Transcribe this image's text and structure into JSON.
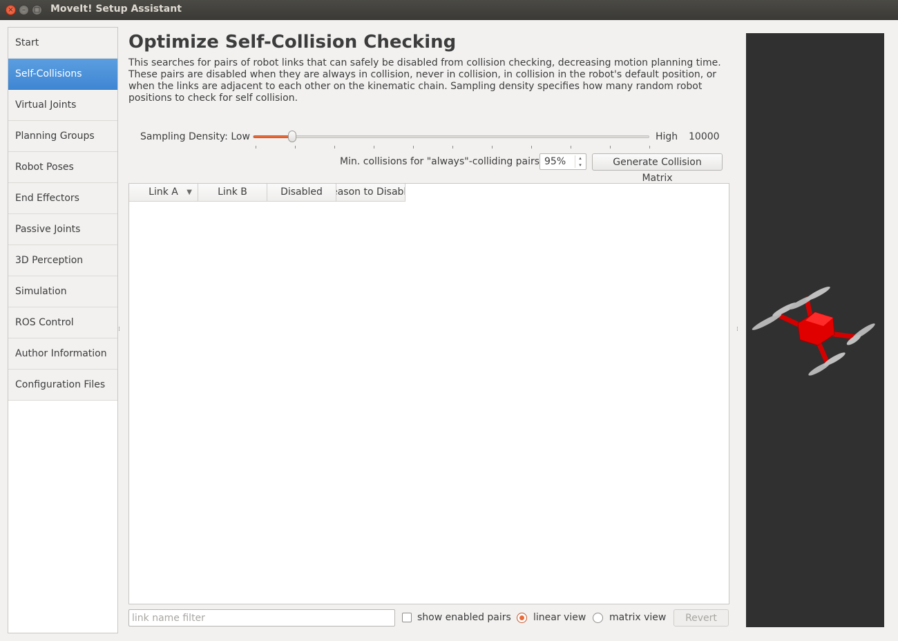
{
  "window": {
    "title": "MoveIt! Setup Assistant",
    "close_glyph": "×",
    "minimize_glyph": "–",
    "maximize_glyph": "□"
  },
  "sidebar": {
    "items": [
      {
        "label": "Start",
        "active": false
      },
      {
        "label": "Self-Collisions",
        "active": true
      },
      {
        "label": "Virtual Joints",
        "active": false
      },
      {
        "label": "Planning Groups",
        "active": false
      },
      {
        "label": "Robot Poses",
        "active": false
      },
      {
        "label": "End Effectors",
        "active": false
      },
      {
        "label": "Passive Joints",
        "active": false
      },
      {
        "label": "3D Perception",
        "active": false
      },
      {
        "label": "Simulation",
        "active": false
      },
      {
        "label": "ROS Control",
        "active": false
      },
      {
        "label": "Author Information",
        "active": false
      },
      {
        "label": "Configuration Files",
        "active": false
      }
    ]
  },
  "main": {
    "title": "Optimize Self-Collision Checking",
    "description": "This searches for pairs of robot links that can safely be disabled from collision checking, decreasing motion planning time. These pairs are disabled when they are always in collision, never in collision, in collision in the robot's default position, or when the links are adjacent to each other on the kinematic chain. Sampling density specifies how many random robot positions to check for self collision.",
    "sampling": {
      "label": "Sampling Density: Low",
      "high_label": "High",
      "value": "10000",
      "slider_fraction": 0.1
    },
    "min_collisions": {
      "label": "Min. collisions for \"always\"-colliding pairs:",
      "value": "95%"
    },
    "generate_button": "Generate Collision Matrix",
    "table": {
      "columns": [
        "Link A",
        "Link B",
        "Disabled",
        "Reason to Disable"
      ]
    },
    "filter": {
      "placeholder": "link name filter",
      "value": ""
    },
    "show_enabled_pairs": {
      "label": "show enabled pairs",
      "checked": false
    },
    "linear_view": {
      "label": "linear view",
      "checked": true
    },
    "matrix_view": {
      "label": "matrix view",
      "checked": false
    },
    "revert_button": "Revert"
  },
  "colors": {
    "accent": "#e86b3a",
    "selection": "#4a90d9",
    "viewport_bg": "#303030",
    "robot": "#e00000"
  },
  "icons": {
    "sort": "chevron-down-icon",
    "spin_up": "▴",
    "spin_down": "▾",
    "splitter": "⁞"
  }
}
